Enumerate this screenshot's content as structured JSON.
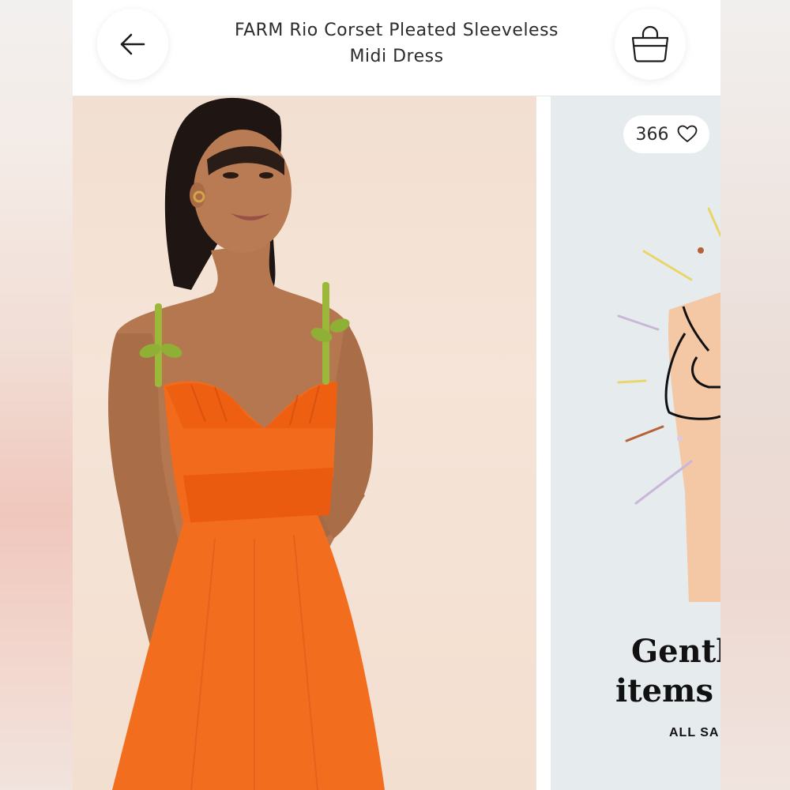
{
  "header": {
    "title_line1": "FARM Rio Corset Pleated Sleeveless",
    "title_line2": "Midi Dress",
    "back_icon": "arrow-left-icon",
    "bag_icon": "shopping-bag-icon"
  },
  "listing": {
    "likes_count": "366",
    "like_icon": "heart-icon"
  },
  "promo": {
    "headline_line1": "Gently",
    "headline_line2": "items",
    "subline": "ALL SA"
  },
  "colors": {
    "dress": "#f26a1b",
    "strap": "#9bb83a",
    "promo_bg": "#e6ebee",
    "photo_bg": "#f3e0d2"
  }
}
